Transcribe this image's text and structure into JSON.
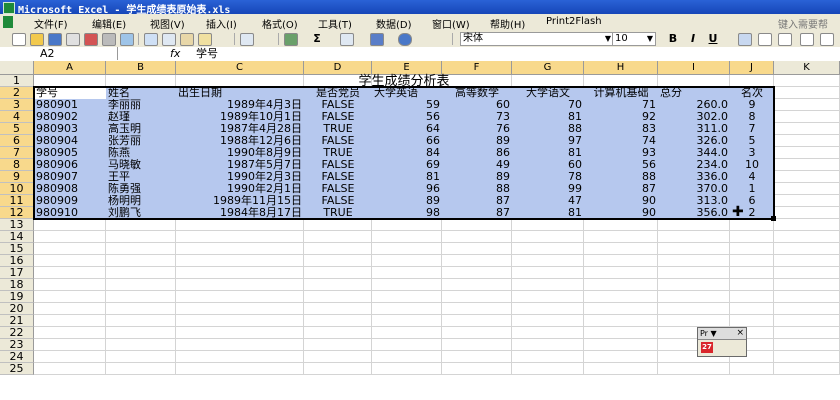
{
  "window": {
    "title": "Microsoft Excel - 学生成绩表原始表.xls"
  },
  "menu": {
    "items": [
      "文件(F)",
      "编辑(E)",
      "视图(V)",
      "插入(I)",
      "格式(O)",
      "工具(T)",
      "数据(D)",
      "窗口(W)",
      "帮助(H)",
      "Print2Flash"
    ],
    "help_placeholder": "键入需要帮"
  },
  "toolbar": {
    "font": "宋体",
    "size": "10",
    "bold": "B",
    "italic": "I",
    "underline": "U",
    "sum": "Σ"
  },
  "formula": {
    "cell_ref": "A2",
    "fx": "fx",
    "content": "学号"
  },
  "sheet": {
    "columns": [
      "A",
      "B",
      "C",
      "D",
      "E",
      "F",
      "G",
      "H",
      "I",
      "J",
      "K"
    ],
    "rows": [
      "1",
      "2",
      "3",
      "4",
      "5",
      "6",
      "7",
      "8",
      "9",
      "10",
      "11",
      "12",
      "13",
      "14",
      "15",
      "16",
      "17",
      "18",
      "19",
      "20",
      "21",
      "22",
      "23",
      "24",
      "25"
    ],
    "title": "学生成绩分析表",
    "headers": [
      "学号",
      "姓名",
      "出生日期",
      "是否党员",
      "大学英语",
      "高等数学",
      "大学语文",
      "计算机基础",
      "总分",
      "名次"
    ],
    "data": [
      [
        "980901",
        "李丽丽",
        "1989年4月3日",
        "FALSE",
        "59",
        "60",
        "70",
        "71",
        "260.0",
        "9"
      ],
      [
        "980902",
        "赵瑾",
        "1989年10月1日",
        "FALSE",
        "56",
        "73",
        "81",
        "92",
        "302.0",
        "8"
      ],
      [
        "980903",
        "高玉明",
        "1987年4月28日",
        "TRUE",
        "64",
        "76",
        "88",
        "83",
        "311.0",
        "7"
      ],
      [
        "980904",
        "张芳丽",
        "1988年12月6日",
        "FALSE",
        "66",
        "89",
        "97",
        "74",
        "326.0",
        "5"
      ],
      [
        "980905",
        "陈燕",
        "1990年8月9日",
        "TRUE",
        "84",
        "86",
        "81",
        "93",
        "344.0",
        "3"
      ],
      [
        "980906",
        "马晓敏",
        "1987年5月7日",
        "FALSE",
        "69",
        "49",
        "60",
        "56",
        "234.0",
        "10"
      ],
      [
        "980907",
        "王平",
        "1990年2月3日",
        "FALSE",
        "81",
        "89",
        "78",
        "88",
        "336.0",
        "4"
      ],
      [
        "980908",
        "陈勇强",
        "1990年2月1日",
        "FALSE",
        "96",
        "88",
        "99",
        "87",
        "370.0",
        "1"
      ],
      [
        "980909",
        "杨明明",
        "1989年11月15日",
        "FALSE",
        "89",
        "87",
        "47",
        "90",
        "313.0",
        "6"
      ],
      [
        "980910",
        "刘鹏飞",
        "1984年8月17日",
        "TRUE",
        "98",
        "87",
        "81",
        "90",
        "356.0",
        "2"
      ]
    ]
  },
  "floating_toolbar": {
    "title": "Pr",
    "close": "×",
    "icon_text": "27"
  }
}
